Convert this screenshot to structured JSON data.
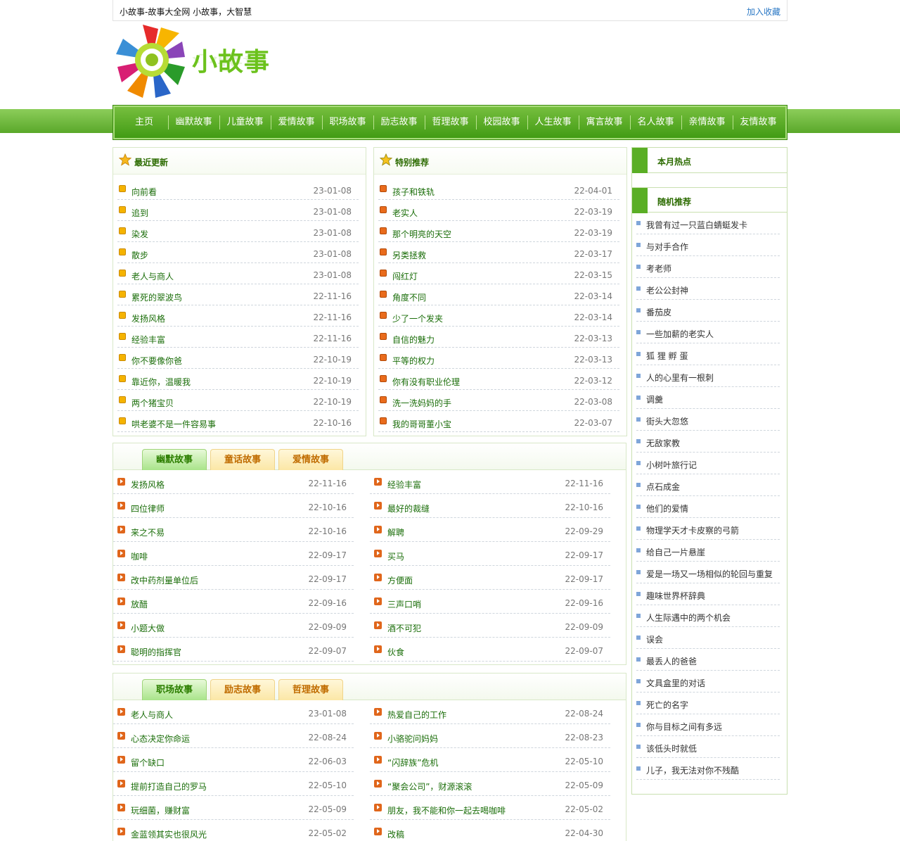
{
  "header": {
    "site_title": "小故事-故事大全网 小故事，大智慧",
    "favorite_link": "加入收藏",
    "logo_text": "小故事"
  },
  "nav": [
    "主页",
    "幽默故事",
    "儿童故事",
    "爱情故事",
    "职场故事",
    "励志故事",
    "哲理故事",
    "校园故事",
    "人生故事",
    "寓言故事",
    "名人故事",
    "亲情故事",
    "友情故事"
  ],
  "recent": {
    "title": "最近更新",
    "items": [
      {
        "t": "向前看",
        "d": "23-01-08"
      },
      {
        "t": "追到",
        "d": "23-01-08"
      },
      {
        "t": "染发",
        "d": "23-01-08"
      },
      {
        "t": "散步",
        "d": "23-01-08"
      },
      {
        "t": "老人与商人",
        "d": "23-01-08"
      },
      {
        "t": "累死的翠波鸟",
        "d": "22-11-16"
      },
      {
        "t": "发扬风格",
        "d": "22-11-16"
      },
      {
        "t": "经验丰富",
        "d": "22-11-16"
      },
      {
        "t": "你不要像你爸",
        "d": "22-10-19"
      },
      {
        "t": "靠近你，温暖我",
        "d": "22-10-19"
      },
      {
        "t": "两个猪宝贝",
        "d": "22-10-19"
      },
      {
        "t": "哄老婆不是一件容易事",
        "d": "22-10-16"
      }
    ]
  },
  "featured": {
    "title": "特别推荐",
    "items": [
      {
        "t": "孩子和铁轨",
        "d": "22-04-01"
      },
      {
        "t": "老实人",
        "d": "22-03-19"
      },
      {
        "t": "那个明亮的天空",
        "d": "22-03-19"
      },
      {
        "t": "另类拯救",
        "d": "22-03-17"
      },
      {
        "t": "闯红灯",
        "d": "22-03-15"
      },
      {
        "t": "角度不同",
        "d": "22-03-14"
      },
      {
        "t": "少了一个发夹",
        "d": "22-03-14"
      },
      {
        "t": "自信的魅力",
        "d": "22-03-13"
      },
      {
        "t": "平等的权力",
        "d": "22-03-13"
      },
      {
        "t": "你有没有职业伦理",
        "d": "22-03-12"
      },
      {
        "t": "洗一洗妈妈的手",
        "d": "22-03-08"
      },
      {
        "t": "我的哥哥董小宝",
        "d": "22-03-07"
      }
    ]
  },
  "tabs1": {
    "tabs": [
      "幽默故事",
      "童话故事",
      "爱情故事"
    ],
    "left": [
      {
        "t": "发扬风格",
        "d": "22-11-16"
      },
      {
        "t": "四位律师",
        "d": "22-10-16"
      },
      {
        "t": "来之不易",
        "d": "22-10-16"
      },
      {
        "t": "咖啡",
        "d": "22-09-17"
      },
      {
        "t": "改中药剂量单位后",
        "d": "22-09-17"
      },
      {
        "t": "放醋",
        "d": "22-09-16"
      },
      {
        "t": "小题大做",
        "d": "22-09-09"
      },
      {
        "t": "聪明的指挥官",
        "d": "22-09-07"
      }
    ],
    "right": [
      {
        "t": "经验丰富",
        "d": "22-11-16"
      },
      {
        "t": "最好的裁缝",
        "d": "22-10-16"
      },
      {
        "t": "解聘",
        "d": "22-09-29"
      },
      {
        "t": "买马",
        "d": "22-09-17"
      },
      {
        "t": "方便面",
        "d": "22-09-17"
      },
      {
        "t": "三声口哨",
        "d": "22-09-16"
      },
      {
        "t": "酒不可犯",
        "d": "22-09-09"
      },
      {
        "t": "伙食",
        "d": "22-09-07"
      }
    ]
  },
  "tabs2": {
    "tabs": [
      "职场故事",
      "励志故事",
      "哲理故事"
    ],
    "left": [
      {
        "t": "老人与商人",
        "d": "23-01-08"
      },
      {
        "t": "心态决定你命运",
        "d": "22-08-24"
      },
      {
        "t": "留个缺口",
        "d": "22-06-03"
      },
      {
        "t": "提前打造自己的罗马",
        "d": "22-05-10"
      },
      {
        "t": "玩细菌，赚财富",
        "d": "22-05-09"
      },
      {
        "t": "金蓝领其实也很风光",
        "d": "22-05-02"
      }
    ],
    "right": [
      {
        "t": "热爱自己的工作",
        "d": "22-08-24"
      },
      {
        "t": "小骆驼问妈妈",
        "d": "22-08-23"
      },
      {
        "t": "“闪辞族”危机",
        "d": "22-05-10"
      },
      {
        "t": "“聚会公司”，财源滚滚",
        "d": "22-05-09"
      },
      {
        "t": "朋友，我不能和你一起去喝咖啡",
        "d": "22-05-02"
      },
      {
        "t": "改稿",
        "d": "22-04-30"
      }
    ]
  },
  "sidebar": {
    "hot_title": "本月热点",
    "random_title": "随机推荐",
    "items": [
      "我曾有过一只蓝白蜻蜓发卡",
      "与对手合作",
      "考老师",
      "老公公封神",
      "番茄皮",
      "一些加薪的老实人",
      "狐 狸 孵 蛋",
      "人的心里有一根刺",
      "调羹",
      "街头大忽悠",
      "无敌家教",
      "小树叶旅行记",
      "点石成金",
      "他们的爱情",
      "物理学天才卡皮察的弓箭",
      "给自己一片悬崖",
      "爱是一场又一场相似的轮回与重复",
      "趣味世界杯辞典",
      "人生际遇中的两个机会",
      "误会",
      "最丢人的爸爸",
      "文具盒里的对话",
      "死亡的名字",
      "你与目标之间有多远",
      "该低头时就低",
      "儿子，我无法对你不残酷"
    ]
  }
}
